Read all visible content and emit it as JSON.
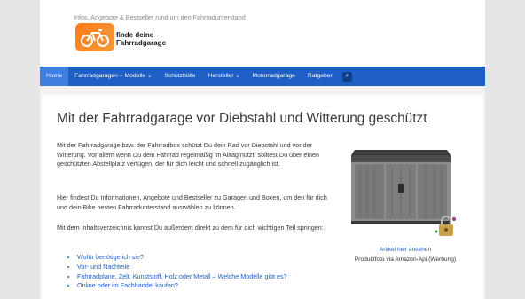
{
  "header": {
    "tagline": "Infos, Angebote & Bestseller rund um den Fahrradunterstand",
    "logo_line1": "finde deine",
    "logo_line2": "Fahrradgarage"
  },
  "nav": {
    "items": [
      {
        "label": "Home",
        "active": true
      },
      {
        "label": "Fahrradgaragen – Modelle",
        "chevron": "chevron-down-icon"
      },
      {
        "label": "Schutzhülle"
      },
      {
        "label": "Hersteller",
        "chevron": "chevron-down-icon"
      },
      {
        "label": "Motorradgarage"
      },
      {
        "label": "Ratgeber"
      }
    ],
    "search_icon": "search-icon"
  },
  "main": {
    "title": "Mit der Fahrradgarage vor Diebstahl und Witterung geschützt",
    "paragraphs": [
      "Mit der Fahrradgarage bzw. der Fahrradbox schützt Du dein Rad vor Diebstahl und vor der Witterung. Vor allem wenn Du dein Fahrrad regelmäßig im Alltag nutzt, solltest Du über einen geschützten Abstellplatz verfügen, der für dich leicht und schnell zugänglich ist.",
      "Hier findest Du Informationen, Angebote und Bestseller zu Garagen und Boxen, um den für dich und dein Bike besten Fahrradunterstand auswählen zu können.",
      "Mit dem Inhaltsverzeichnis kannst Du außerdem direkt zu dem für dich wichtigen Teil springen:"
    ],
    "toc": [
      "Wofür benötige ich sie?",
      "Vor- und Nachteile",
      "Fahrradplane, Zelt, Kunststoff, Holz oder Metall – Welche Modelle gibt es?",
      "Online oder im Fachhandel kaufen?"
    ]
  },
  "product": {
    "link_text": "Artikel hier ansehen",
    "caption": "Produktfoto via Amazon-Api  (Werbung)"
  },
  "colors": {
    "nav_bg": "#1e5fc4",
    "nav_active": "#3f7fe0",
    "logo_orange": "#ff7a1a",
    "link": "#1e5fc4"
  }
}
